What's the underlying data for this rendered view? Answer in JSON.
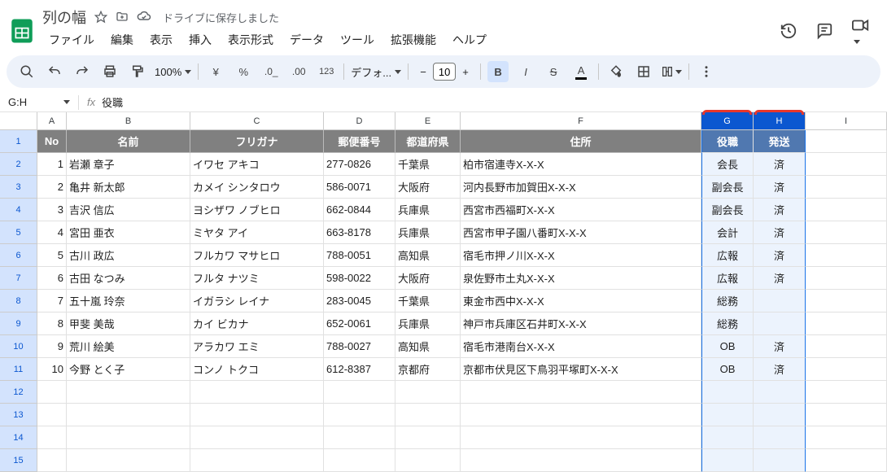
{
  "doc": {
    "title": "列の幅",
    "drive_status": "ドライブに保存しました"
  },
  "menu": [
    "ファイル",
    "編集",
    "表示",
    "挿入",
    "表示形式",
    "データ",
    "ツール",
    "拡張機能",
    "ヘルプ"
  ],
  "toolbar": {
    "zoom": "100%",
    "font": "デフォ...",
    "font_size": "10"
  },
  "formula": {
    "name_box": "G:H",
    "fx": "役職"
  },
  "columns": [
    "A",
    "B",
    "C",
    "D",
    "E",
    "F",
    "G",
    "H",
    "I"
  ],
  "selected_cols": [
    "G",
    "H"
  ],
  "headers": {
    "no": "No",
    "name": "名前",
    "furigana": "フリガナ",
    "zip": "郵便番号",
    "pref": "都道府県",
    "addr": "住所",
    "role": "役職",
    "ship": "発送"
  },
  "rows": [
    {
      "no": "1",
      "name": "岩瀬 章子",
      "furigana": "イワセ アキコ",
      "zip": "277-0826",
      "pref": "千葉県",
      "addr": "柏市宿連寺X-X-X",
      "role": "会長",
      "ship": "済"
    },
    {
      "no": "2",
      "name": "亀井 新太郎",
      "furigana": "カメイ シンタロウ",
      "zip": "586-0071",
      "pref": "大阪府",
      "addr": "河内長野市加賀田X-X-X",
      "role": "副会長",
      "ship": "済"
    },
    {
      "no": "3",
      "name": "吉沢 信広",
      "furigana": "ヨシザワ ノブヒロ",
      "zip": "662-0844",
      "pref": "兵庫県",
      "addr": "西宮市西福町X-X-X",
      "role": "副会長",
      "ship": "済"
    },
    {
      "no": "4",
      "name": "宮田 亜衣",
      "furigana": "ミヤタ アイ",
      "zip": "663-8178",
      "pref": "兵庫県",
      "addr": "西宮市甲子園八番町X-X-X",
      "role": "会計",
      "ship": "済"
    },
    {
      "no": "5",
      "name": "古川 政広",
      "furigana": "フルカワ マサヒロ",
      "zip": "788-0051",
      "pref": "高知県",
      "addr": "宿毛市押ノ川X-X-X",
      "role": "広報",
      "ship": "済"
    },
    {
      "no": "6",
      "name": "古田 なつみ",
      "furigana": "フルタ ナツミ",
      "zip": "598-0022",
      "pref": "大阪府",
      "addr": "泉佐野市土丸X-X-X",
      "role": "広報",
      "ship": "済"
    },
    {
      "no": "7",
      "name": "五十嵐 玲奈",
      "furigana": "イガラシ レイナ",
      "zip": "283-0045",
      "pref": "千葉県",
      "addr": "東金市西中X-X-X",
      "role": "総務",
      "ship": ""
    },
    {
      "no": "8",
      "name": "甲斐 美哉",
      "furigana": "カイ ビカナ",
      "zip": "652-0061",
      "pref": "兵庫県",
      "addr": "神戸市兵庫区石井町X-X-X",
      "role": "総務",
      "ship": ""
    },
    {
      "no": "9",
      "name": "荒川 絵美",
      "furigana": "アラカワ エミ",
      "zip": "788-0027",
      "pref": "高知県",
      "addr": "宿毛市港南台X-X-X",
      "role": "OB",
      "ship": "済"
    },
    {
      "no": "10",
      "name": "今野 とく子",
      "furigana": "コンノ トクコ",
      "zip": "612-8387",
      "pref": "京都府",
      "addr": "京都市伏見区下鳥羽平塚町X-X-X",
      "role": "OB",
      "ship": "済"
    }
  ],
  "empty_rows": 4
}
